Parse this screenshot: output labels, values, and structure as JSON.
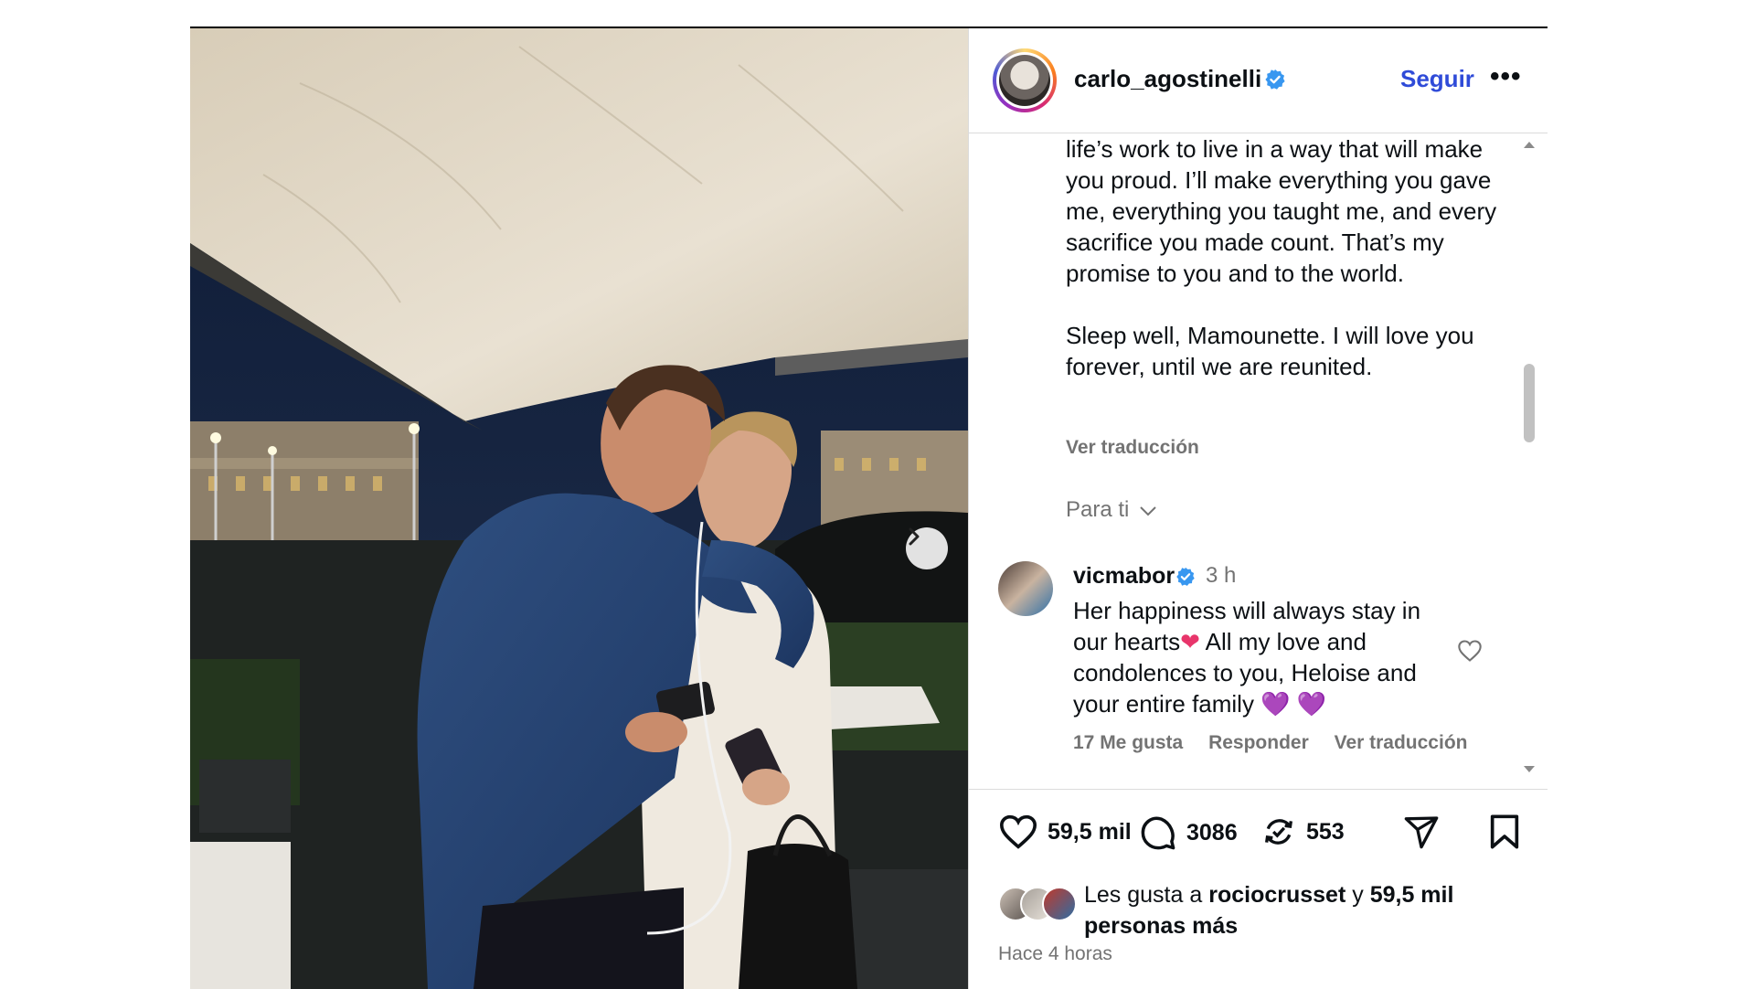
{
  "post": {
    "author": {
      "username": "carlo_agostinelli",
      "verified": true,
      "follow_label": "Seguir",
      "more_icon": "more-horizontal-icon"
    },
    "caption": {
      "line_1": "life’s work to live in a way that will make you proud. I’ll make everything you gave me, everything you taught me, and every sacrifice you made count. That’s my promise to you and to the world.",
      "line_2": "Sleep well, Mamounette. I will love you forever, until we are reunited.",
      "see_translation": "Ver traducción"
    },
    "sort_label": "Para ti",
    "comment": {
      "username": "vicmabor",
      "verified": true,
      "time": "3 h",
      "text_a": "Her happiness will always stay in our hearts",
      "heart_1": "❤",
      "text_b": " All my love and condolences to you, Heloise and your entire family ",
      "heart_2": "💜 💜",
      "likes": "17 Me gusta",
      "reply": "Responder",
      "translate": "Ver traducción"
    },
    "actions": {
      "like_count": "59,5 mil",
      "comment_count": "3086",
      "repost_count": "553"
    },
    "liked_by": {
      "prefix": "Les gusta a ",
      "user": "rociocrusset",
      "connector": " y ",
      "count": "59,5 mil",
      "suffix": "personas más"
    },
    "time_ago": "Hace 4 horas"
  },
  "colors": {
    "accent_blue": "#2f4bd8",
    "verified_blue": "#3897f0",
    "muted_text": "#737373",
    "border": "#dbdbdb"
  }
}
